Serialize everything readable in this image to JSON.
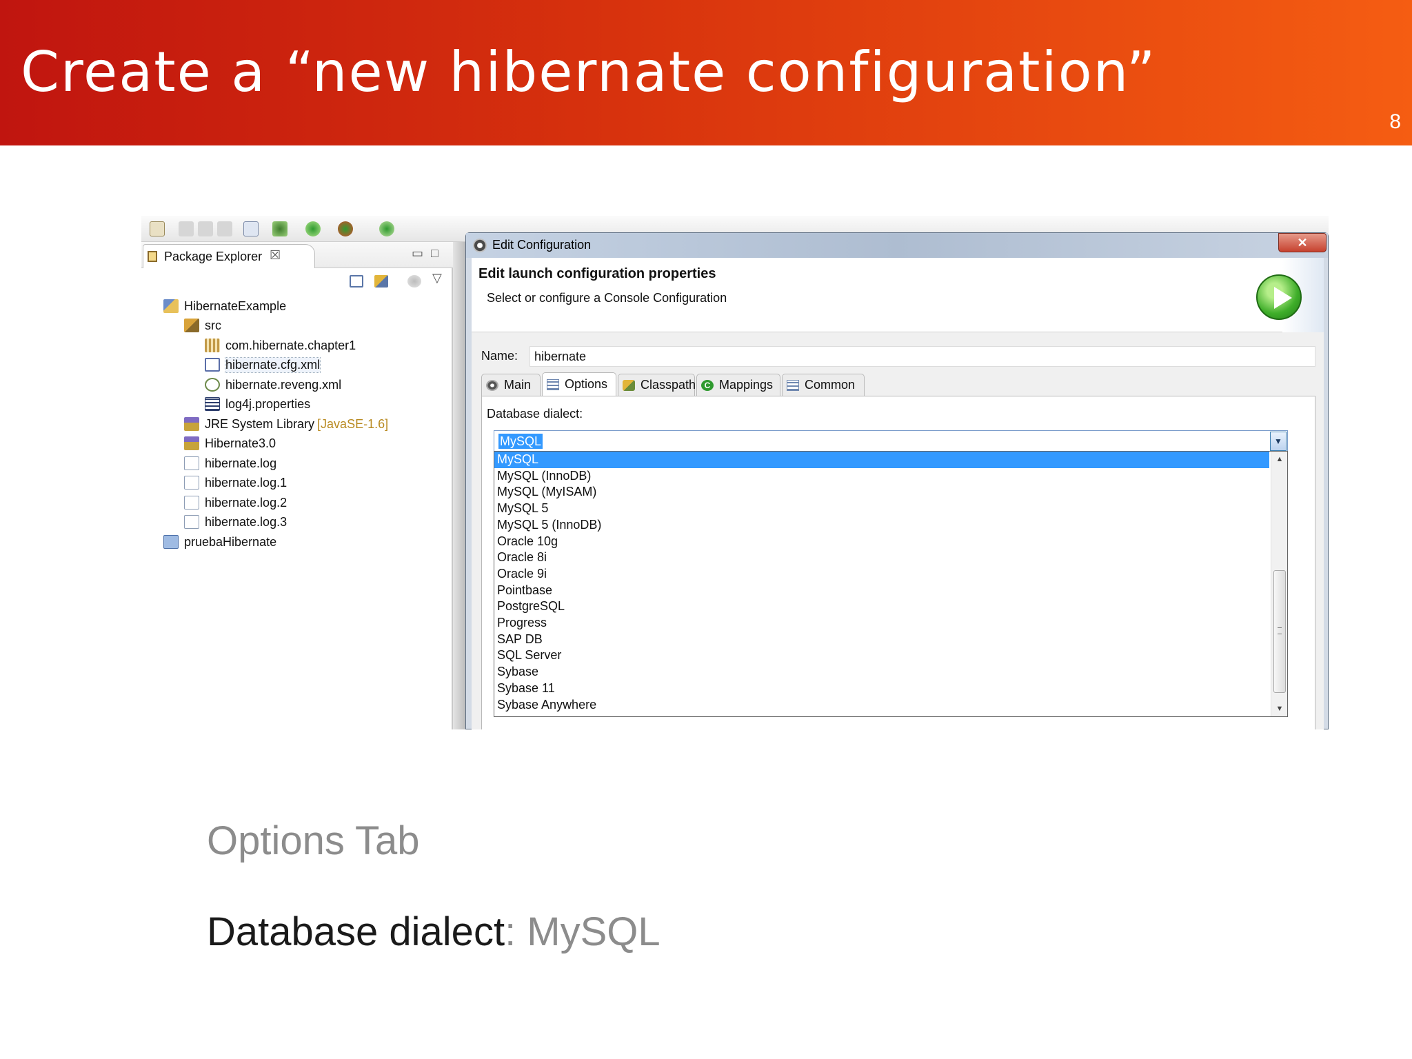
{
  "slide": {
    "title": "Create a “new hibernate configuration”",
    "page_number": "8",
    "subheading": "Options Tab",
    "detail": {
      "key": "Database dialect",
      "separator": ": ",
      "value": "MySQL"
    },
    "colors": {
      "header_start": "#c0150f",
      "header_end": "#f55d12",
      "muted_text": "#8c8c8c"
    }
  },
  "package_explorer": {
    "tab_label": "Package Explorer",
    "close_glyph": "☒",
    "minimize_glyph": "▭",
    "maximize_glyph": "□",
    "view_menu_glyph": "▽",
    "tree": [
      {
        "label": "HibernateExample",
        "icon": "java-project-icon"
      },
      {
        "label": "src",
        "icon": "source-folder-icon"
      },
      {
        "label": "com.hibernate.chapter1",
        "icon": "package-icon"
      },
      {
        "label": "hibernate.cfg.xml",
        "icon": "hibernate-xml-icon"
      },
      {
        "label": "hibernate.reveng.xml",
        "icon": "reveng-xml-icon"
      },
      {
        "label": "log4j.properties",
        "icon": "properties-file-icon"
      },
      {
        "label": "JRE System Library",
        "decoration": "[JavaSE-1.6]",
        "icon": "library-icon"
      },
      {
        "label": "Hibernate3.0",
        "icon": "library-icon"
      },
      {
        "label": "hibernate.log",
        "icon": "text-file-icon"
      },
      {
        "label": "hibernate.log.1",
        "icon": "text-file-icon"
      },
      {
        "label": "hibernate.log.2",
        "icon": "text-file-icon"
      },
      {
        "label": "hibernate.log.3",
        "icon": "text-file-icon"
      },
      {
        "label": "pruebaHibernate",
        "icon": "project-icon"
      }
    ]
  },
  "dialog": {
    "title": "Edit Configuration",
    "close_glyph": "✕",
    "header_title": "Edit launch configuration properties",
    "header_subtitle": "Select or configure a Console Configuration",
    "name_label": "Name:",
    "name_value": "hibernate",
    "tabs": [
      {
        "label": "Main",
        "icon": "main-tab-icon"
      },
      {
        "label": "Options",
        "icon": "options-tab-icon",
        "active": true
      },
      {
        "label": "Classpath",
        "icon": "classpath-tab-icon"
      },
      {
        "label": "Mappings",
        "icon": "mappings-tab-icon",
        "icon_glyph": "C"
      },
      {
        "label": "Common",
        "icon": "common-tab-icon"
      }
    ],
    "dialect_label": "Database dialect:",
    "dialect_value": "MySQL",
    "dialect_options": [
      "MySQL",
      "MySQL (InnoDB)",
      "MySQL (MyISAM)",
      "MySQL 5",
      "MySQL 5 (InnoDB)",
      "Oracle 10g",
      "Oracle 8i",
      "Oracle 9i",
      "Pointbase",
      "PostgreSQL",
      "Progress",
      "SAP DB",
      "SQL Server",
      "Sybase",
      "Sybase 11",
      "Sybase Anywhere"
    ],
    "selected_option_index": 0,
    "scroll_glyphs": {
      "up": "▲",
      "down": "▼",
      "arrow": "▼"
    }
  }
}
